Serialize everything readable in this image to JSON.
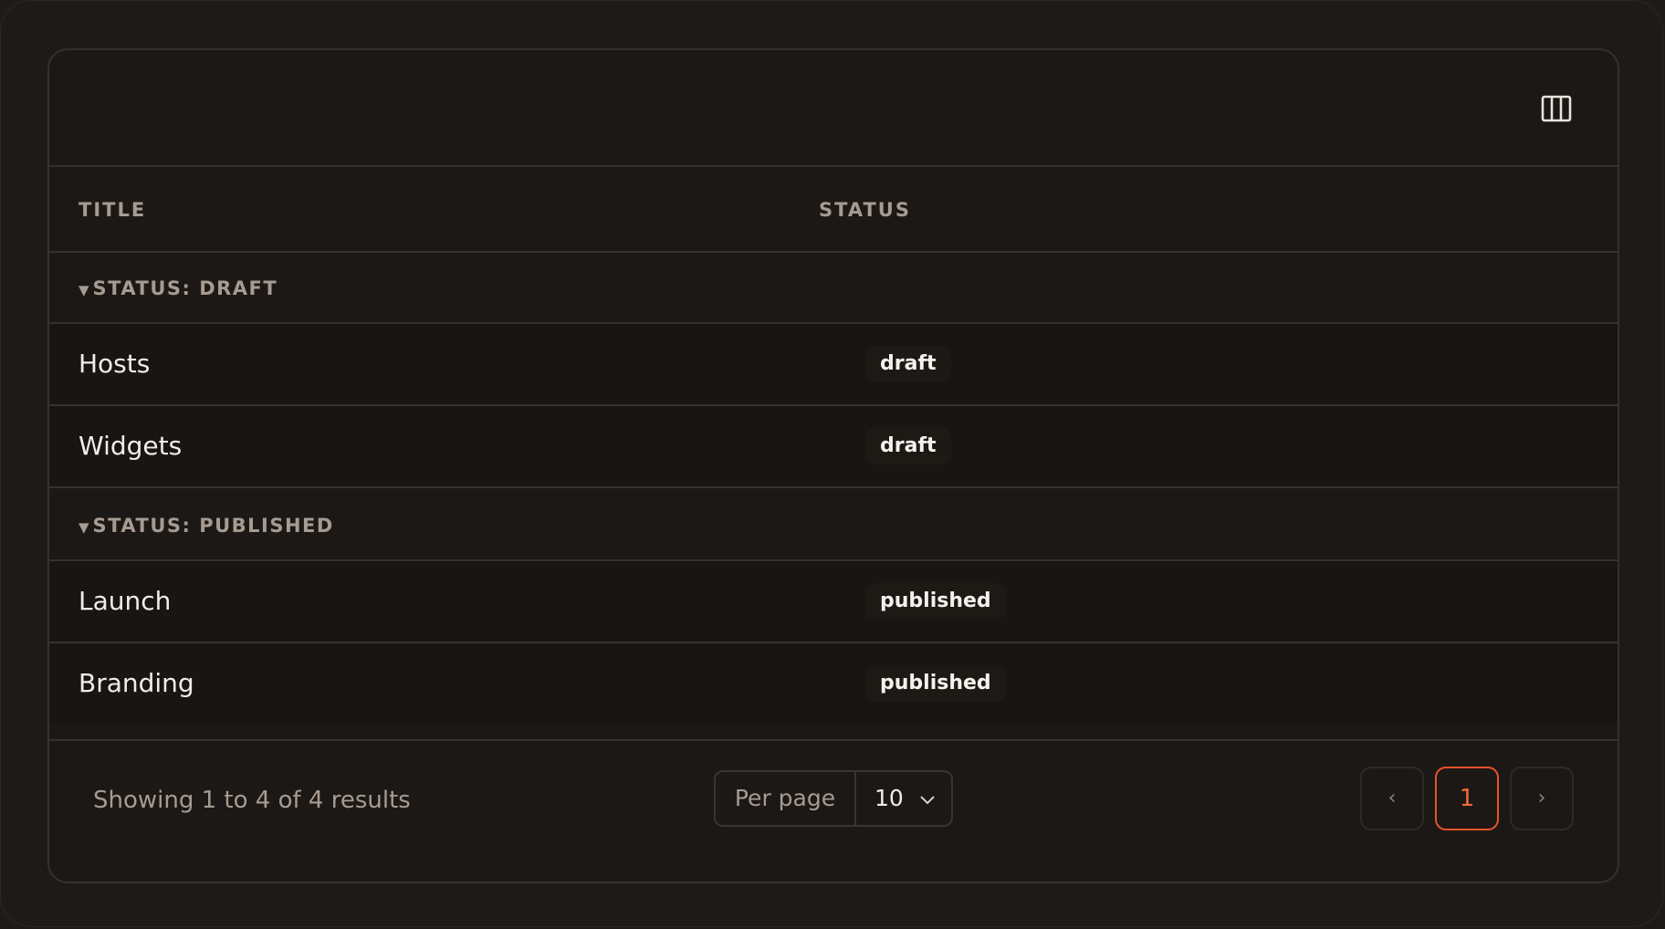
{
  "toolbar": {
    "columns_icon": "columns-icon"
  },
  "table": {
    "headers": {
      "title": "TITLE",
      "status": "STATUS"
    },
    "groups": [
      {
        "label": "STATUS: DRAFT",
        "toggle_glyph": "▼",
        "rows": [
          {
            "title": "Hosts",
            "status": "draft"
          },
          {
            "title": "Widgets",
            "status": "draft"
          }
        ]
      },
      {
        "label": "STATUS: PUBLISHED",
        "toggle_glyph": "▼",
        "rows": [
          {
            "title": "Launch",
            "status": "published"
          },
          {
            "title": "Branding",
            "status": "published"
          }
        ]
      }
    ]
  },
  "footer": {
    "results_text": "Showing 1 to 4 of 4 results",
    "per_page_label": "Per page",
    "per_page_value": "10",
    "pagination": {
      "prev": "‹",
      "current": "1",
      "next": "›"
    }
  },
  "colors": {
    "accent": "#e8542b",
    "background": "#1e1a17",
    "border": "#37312c"
  }
}
